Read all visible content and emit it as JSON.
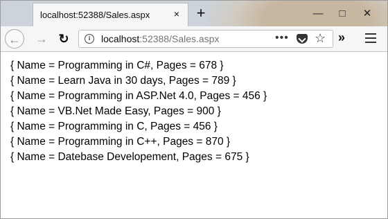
{
  "tab": {
    "title": "localhost:52388/Sales.aspx"
  },
  "urlbar": {
    "host": "localhost",
    "rest": ":52388/Sales.aspx"
  },
  "icons": {
    "close": "×",
    "new_tab": "+",
    "minimize": "—",
    "maximize": "□",
    "win_close": "✕",
    "back": "←",
    "forward": "→",
    "reload": "↻",
    "info": "i",
    "more": "•••",
    "star": "☆",
    "overflow": "»"
  },
  "output_lines": [
    "{ Name = Programming in C#, Pages = 678 }",
    "{ Name = Learn Java in 30 days, Pages = 789 }",
    "{ Name = Programming in ASP.Net 4.0, Pages = 456 }",
    "{ Name = VB.Net Made Easy, Pages = 900 }",
    "{ Name = Programming in C, Pages = 456 }",
    "{ Name = Programming in C++, Pages = 870 }",
    "{ Name = Datebase Developement, Pages = 675 }"
  ]
}
